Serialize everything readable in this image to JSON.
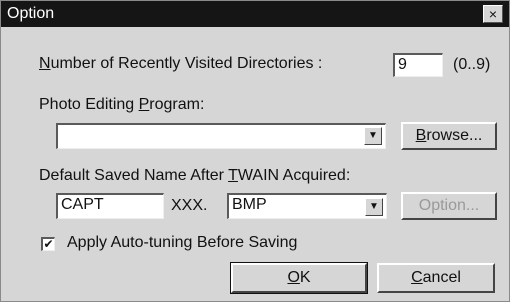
{
  "window": {
    "title": "Option",
    "close_glyph": "×"
  },
  "recent": {
    "label_first": "N",
    "label_rest": "umber of Recently Visited Directories :",
    "value": "9",
    "range": "(0..9)"
  },
  "photo": {
    "label_start": "Photo Editing ",
    "label_u": "P",
    "label_end": "rogram:",
    "value": "",
    "browse_first": "B",
    "browse_rest": "rowse..."
  },
  "saved": {
    "label_start": "Default Saved Name After ",
    "label_u": "T",
    "label_end": "WAIN Acquired:",
    "prefix": "CAPT",
    "suffix": "XXX.",
    "format": "BMP",
    "option_label": "Option..."
  },
  "autotune": {
    "checked": "✔",
    "label": "Apply Auto-tuning Before Saving"
  },
  "buttons": {
    "ok_first": "O",
    "ok_rest": "K",
    "cancel_first": "C",
    "cancel_rest": "ancel"
  },
  "icons": {
    "dropdown": "▼"
  }
}
